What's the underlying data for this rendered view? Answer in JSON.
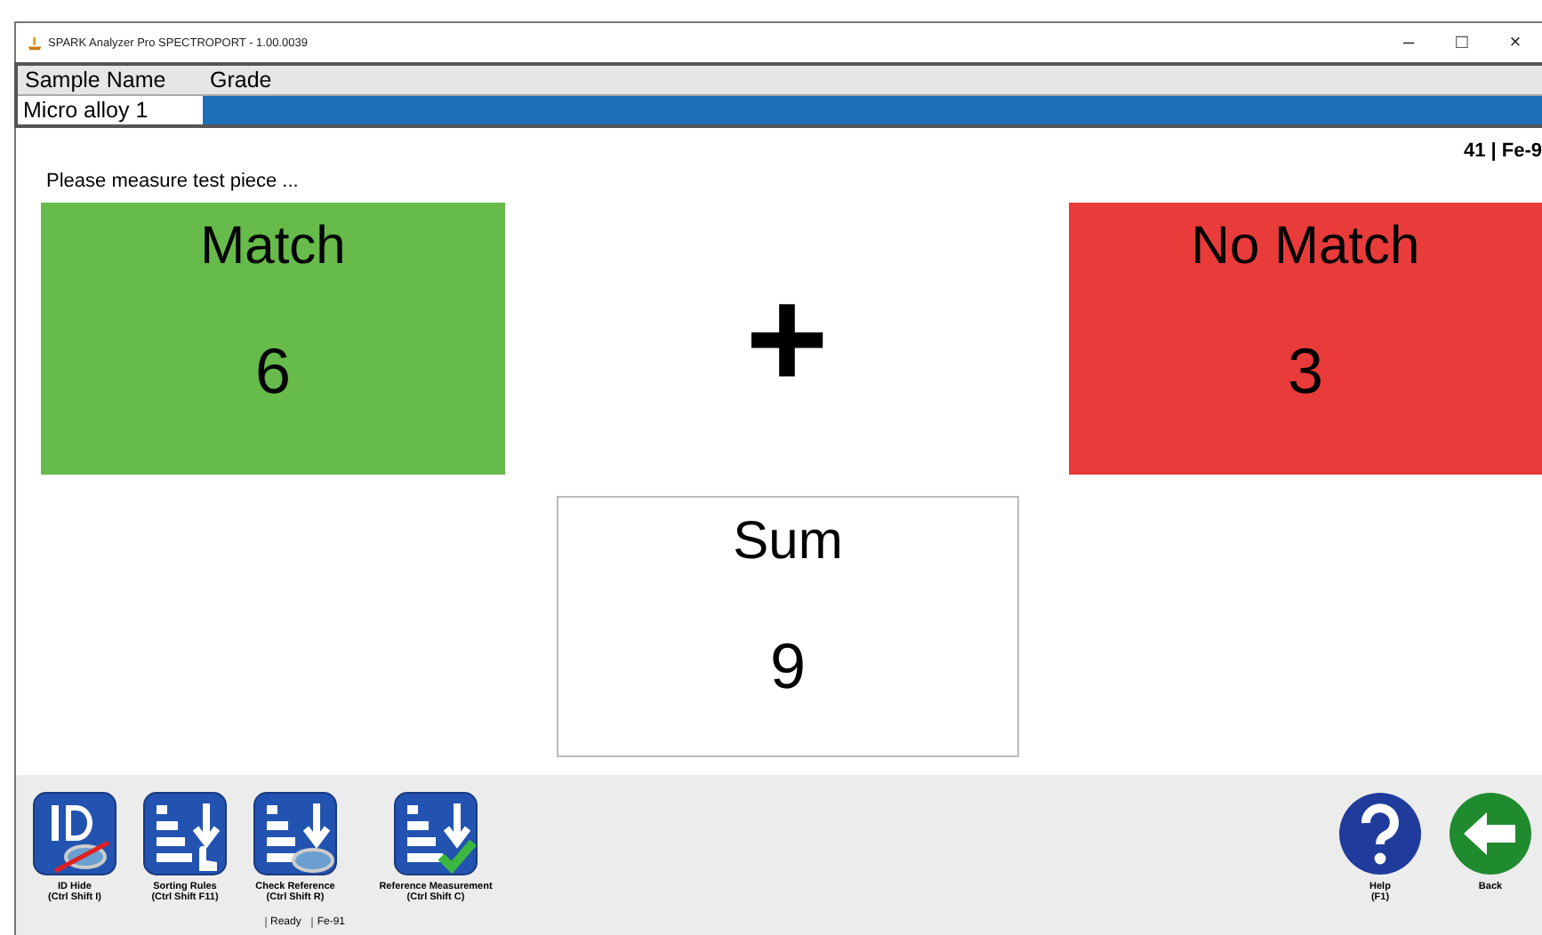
{
  "window": {
    "title": "SPARK Analyzer Pro SPECTROPORT - 1.00.0039",
    "controls": [
      "–",
      "□",
      "×"
    ]
  },
  "sample_table": {
    "columns": [
      "Sample Name",
      "Grade"
    ],
    "rows": [
      {
        "cells": [
          "Micro alloy 1"
        ],
        "selected": true
      }
    ]
  },
  "info": {
    "message": "Please measure test piece ...",
    "grade_reading": "41 | Fe-9"
  },
  "results": [
    {
      "kind": "match",
      "label": "Match",
      "count": "6",
      "color": "#66bb4a"
    },
    {
      "kind": "no_match",
      "label": "No Match",
      "count": "3",
      "color": "#ea3b3b"
    },
    {
      "kind": "sum",
      "label": "Sum",
      "count": "9",
      "color": "#ffffff"
    }
  ],
  "operator": "+",
  "toolbar": [
    {
      "kind": "id-hide",
      "label": "ID Hide",
      "shortcut": "(Ctrl Shift I)"
    },
    {
      "kind": "sorting",
      "label": "Sorting Rules",
      "shortcut": "(Ctrl Shift F11)"
    },
    {
      "kind": "check",
      "label": "Check Reference",
      "shortcut": "(Ctrl Shift R)"
    },
    {
      "kind": "reference",
      "label": "Reference Measurement",
      "shortcut": "(Ctrl Shift C)"
    },
    {
      "kind": "help",
      "label": "Help",
      "shortcut": "(F1)"
    },
    {
      "kind": "back",
      "label": "Back"
    }
  ],
  "status_bar": [
    "Ready",
    "Fe-91"
  ]
}
